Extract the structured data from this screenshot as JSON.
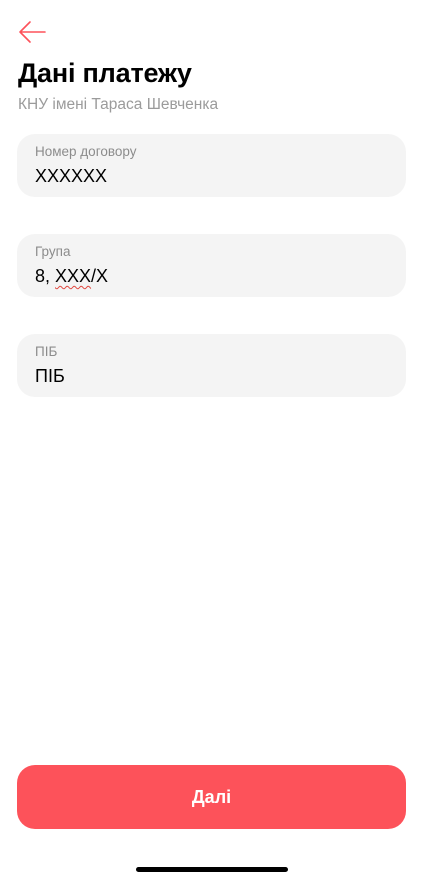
{
  "colors": {
    "accent": "#fd525a",
    "field_background": "#f4f4f4",
    "subtitle": "#9b9b9b",
    "label": "#8c8c8c"
  },
  "header": {
    "back_icon": "arrow-left-icon",
    "title": "Дані платежу",
    "subtitle": "КНУ імені Тараса Шевченка"
  },
  "form": {
    "contract_number": {
      "label": "Номер договору",
      "value": "XXXXXX"
    },
    "group": {
      "label": "Група",
      "value_prefix": "8, ",
      "value_underlined": "XXX",
      "value_suffix": "/X"
    },
    "full_name": {
      "label": "ПІБ",
      "value": "ПІБ"
    }
  },
  "footer": {
    "next_label": "Далі"
  }
}
